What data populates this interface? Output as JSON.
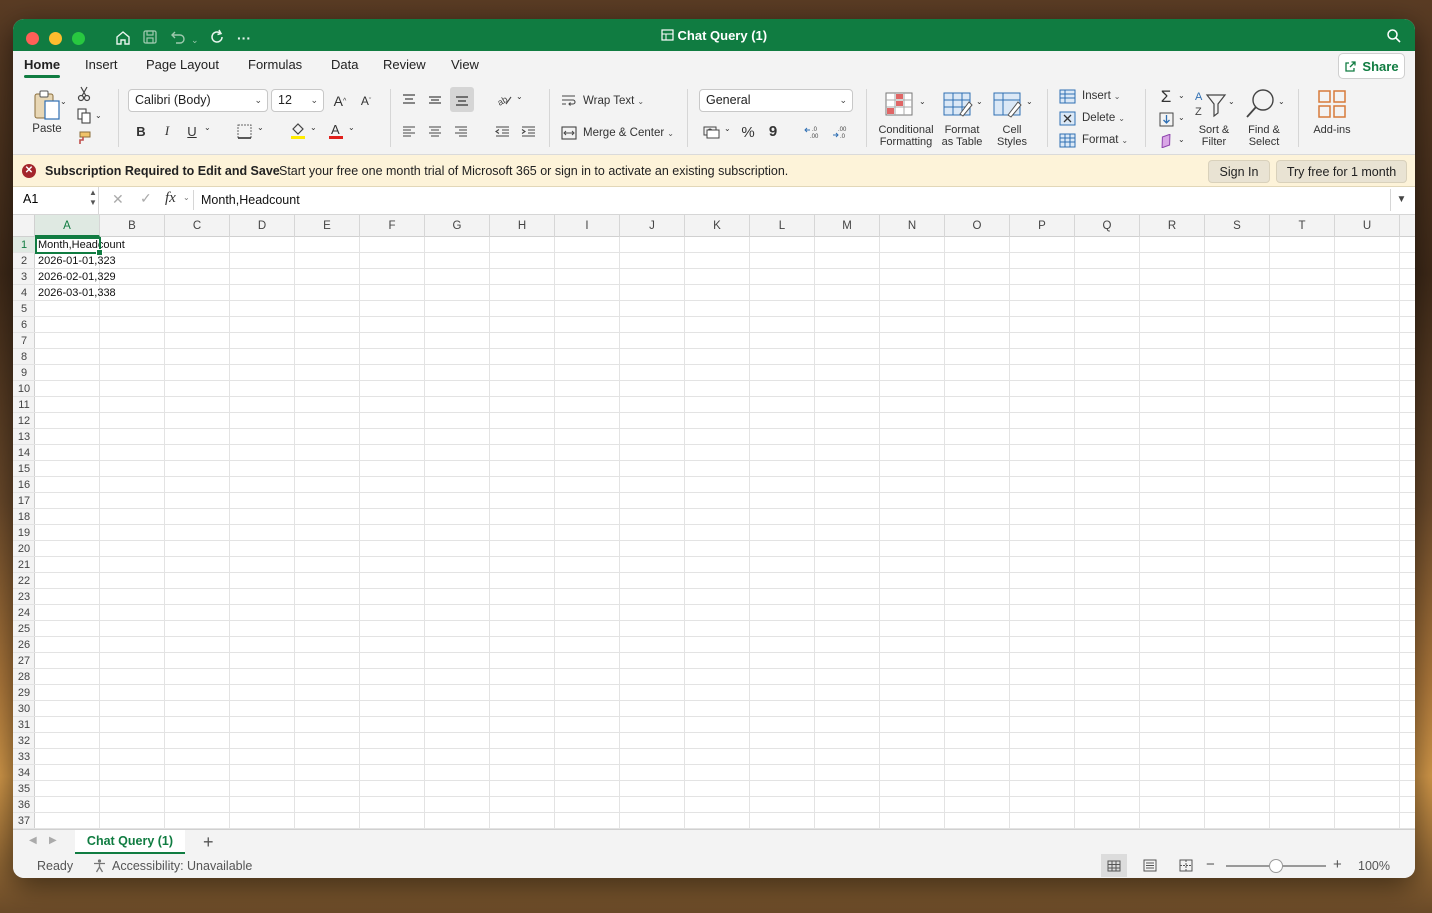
{
  "window": {
    "title": "Chat Query (1)",
    "quick_access": [
      "home-icon",
      "save-icon",
      "undo-icon",
      "redo-icon",
      "more-icon"
    ]
  },
  "tabs": [
    {
      "label": "Home",
      "active": true
    },
    {
      "label": "Insert"
    },
    {
      "label": "Page Layout"
    },
    {
      "label": "Formulas"
    },
    {
      "label": "Data"
    },
    {
      "label": "Review"
    },
    {
      "label": "View"
    }
  ],
  "share_label": "Share",
  "ribbon": {
    "paste": "Paste",
    "font_name": "Calibri (Body)",
    "font_size": "12",
    "bold": "B",
    "italic": "I",
    "underline": "U",
    "wrap_text": "Wrap Text",
    "merge_center": "Merge & Center",
    "number_format": "General",
    "percent": "%",
    "comma": "9",
    "conditional_formatting": [
      "Conditional",
      "Formatting"
    ],
    "format_as_table": [
      "Format",
      "as Table"
    ],
    "cell_styles": [
      "Cell",
      "Styles"
    ],
    "insert": "Insert",
    "delete": "Delete",
    "format": "Format",
    "sort_filter": [
      "Sort &",
      "Filter"
    ],
    "find_select": [
      "Find &",
      "Select"
    ],
    "add_ins": "Add-ins"
  },
  "message_bar": {
    "title": "Subscription Required to Edit and Save",
    "text": "Start your free one month trial of Microsoft 365 or sign in to activate an existing subscription.",
    "sign_in": "Sign In",
    "try_free": "Try free for 1 month"
  },
  "formula_bar": {
    "name_box": "A1",
    "fx": "fx",
    "value": "Month,Headcount"
  },
  "columns": [
    "A",
    "B",
    "C",
    "D",
    "E",
    "F",
    "G",
    "H",
    "I",
    "J",
    "K",
    "L",
    "M",
    "N",
    "O",
    "P",
    "Q",
    "R",
    "S",
    "T",
    "U"
  ],
  "rows": [
    "1",
    "2",
    "3",
    "4",
    "5",
    "6",
    "7",
    "8",
    "9",
    "10",
    "11",
    "12",
    "13",
    "14",
    "15",
    "16",
    "17",
    "18",
    "19",
    "20",
    "21",
    "22",
    "23",
    "24",
    "25",
    "26",
    "27",
    "28",
    "29",
    "30",
    "31",
    "32",
    "33",
    "34",
    "35",
    "36",
    "37"
  ],
  "cells": [
    {
      "ref": "A1",
      "value": "Month,Headcount"
    },
    {
      "ref": "A2",
      "value": "2026-01-01,323"
    },
    {
      "ref": "A3",
      "value": "2026-02-01,329"
    },
    {
      "ref": "A4",
      "value": "2026-03-01,338"
    }
  ],
  "selected_cell": "A1",
  "sheet": {
    "name": "Chat Query (1)",
    "add": "+"
  },
  "status": {
    "ready": "Ready",
    "accessibility": "Accessibility: Unavailable",
    "zoom": "100%",
    "zoom_minus": "−",
    "zoom_plus": "+"
  },
  "colors": {
    "brand": "#107c41",
    "message_bar": "#fdf3d9"
  }
}
